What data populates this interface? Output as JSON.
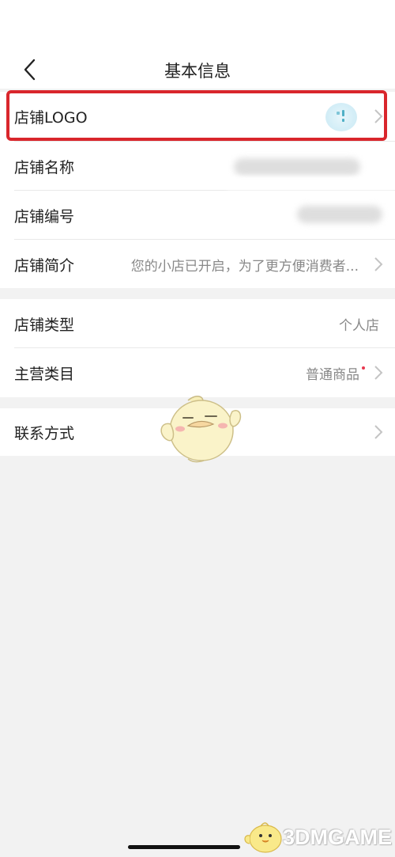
{
  "header": {
    "title": "基本信息"
  },
  "basic_section": {
    "rows": [
      {
        "label": "店铺LOGO",
        "value": ""
      },
      {
        "label": "店铺名称",
        "value": ""
      },
      {
        "label": "店铺编号",
        "value": ""
      },
      {
        "label": "店铺简介",
        "value": "您的小店已开启，为了更方便消费者..."
      }
    ]
  },
  "category_section": {
    "rows": [
      {
        "label": "店铺类型",
        "value": "个人店"
      },
      {
        "label": "主营类目",
        "value": "普通商品"
      }
    ]
  },
  "contact_section": {
    "rows": [
      {
        "label": "联系方式",
        "value": ""
      }
    ]
  },
  "watermark": {
    "text": "3DMGAME"
  },
  "icons": [
    "back-icon",
    "chevron-right-icon",
    "logo-avatar",
    "mascot-sticker",
    "watermark-bird-icon"
  ],
  "colors": {
    "highlight": "#d9262c",
    "badge_dot": "#e8384f",
    "background": "#f2f2f2"
  }
}
